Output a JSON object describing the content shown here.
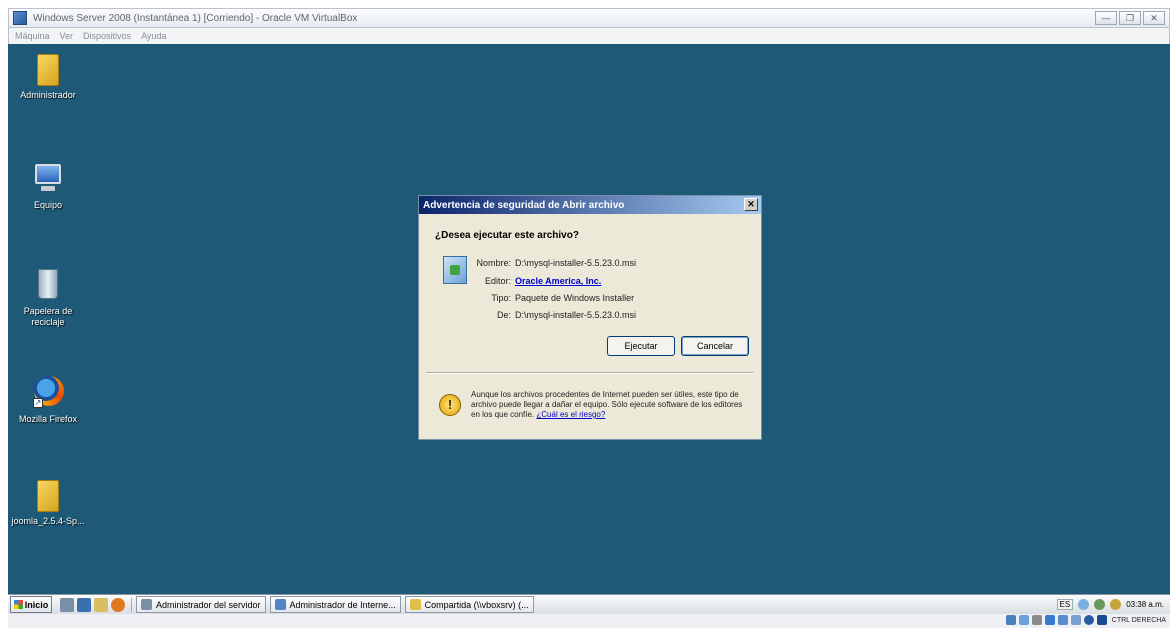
{
  "vbox": {
    "title": "Windows Server 2008 (Instantánea 1) [Corriendo] - Oracle VM VirtualBox",
    "menu": [
      "Máquina",
      "Ver",
      "Dispositivos",
      "Ayuda"
    ],
    "host_key": "CTRL DERECHA"
  },
  "desktop": {
    "icons": [
      {
        "label": "Administrador",
        "icon": "folder-icon"
      },
      {
        "label": "Equipo",
        "icon": "computer-icon"
      },
      {
        "label": "Papelera de reciclaje",
        "icon": "recycle-bin-icon"
      },
      {
        "label": "Mozilla Firefox",
        "icon": "firefox-icon"
      },
      {
        "label": "joomla_2.5.4-Sp...",
        "icon": "folder-icon"
      }
    ]
  },
  "dialog": {
    "title": "Advertencia de seguridad de Abrir archivo",
    "question": "¿Desea ejecutar este archivo?",
    "fields": {
      "name_label": "Nombre:",
      "name_value": "D:\\mysql-installer-5.5.23.0.msi",
      "publisher_label": "Editor:",
      "publisher_value": "Oracle America, Inc.",
      "type_label": "Tipo:",
      "type_value": "Paquete de Windows Installer",
      "from_label": "De:",
      "from_value": "D:\\mysql-installer-5.5.23.0.msi"
    },
    "run_label": "Ejecutar",
    "cancel_label": "Cancelar",
    "warning_text": "Aunque los archivos procedentes de Internet pueden ser útiles, este tipo de archivo puede llegar a dañar el equipo. Sólo ejecute software de los editores en los que confíe.",
    "warning_link": "¿Cuál es el riesgo?"
  },
  "taskbar": {
    "start_label": "Inicio",
    "tasks": [
      "Administrador del servidor",
      "Administrador de Interne...",
      "Compartida (\\\\vboxsrv) (..."
    ],
    "lang": "ES",
    "clock": "03:38 a.m."
  }
}
